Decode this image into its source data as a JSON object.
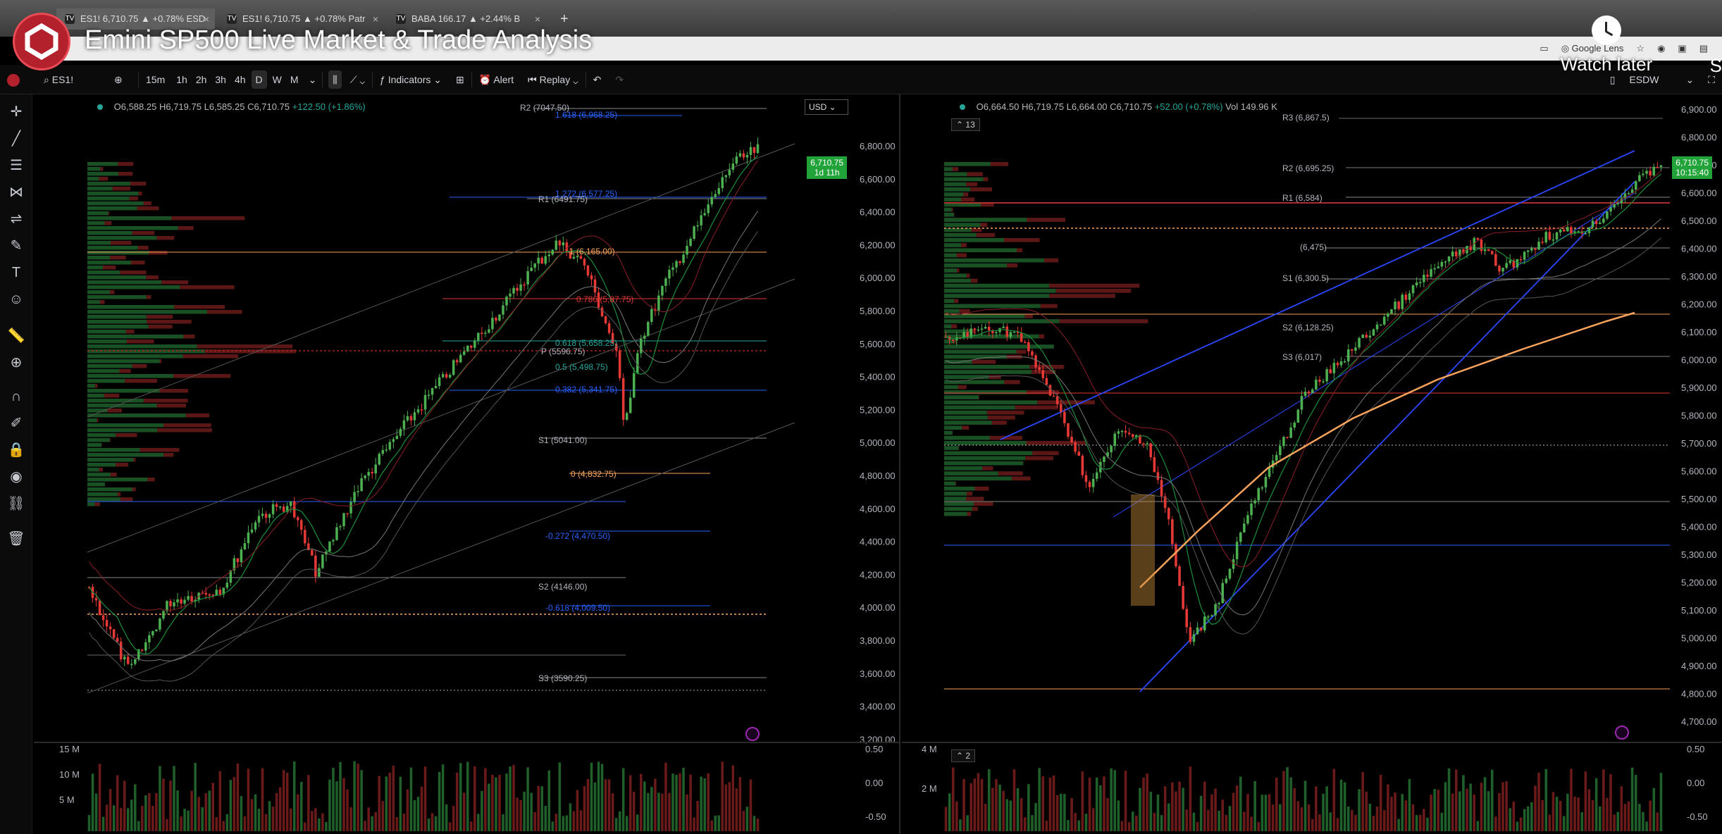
{
  "browser": {
    "tabs": [
      {
        "label": "ES1! 6,710.75 ▲ +0.78% ESD",
        "favicon": "TV"
      },
      {
        "label": "ES1! 6,710.75 ▲ +0.78% Patr",
        "favicon": "TV"
      },
      {
        "label": "BABA 166.17 ▲ +2.44% B",
        "favicon": "TV"
      }
    ],
    "google_lens_label": "Google Lens"
  },
  "video": {
    "title": "Emini SP500 Live Market & Trade Analysis",
    "watch_later": "Watch later",
    "share_initial": "S"
  },
  "toolbar": {
    "symbol": "ES1!",
    "intervals": [
      "15m",
      "1h",
      "2h",
      "3h",
      "4h",
      "D",
      "W",
      "M"
    ],
    "active_interval": "D",
    "indicators_label": "Indicators",
    "alert_label": "Alert",
    "replay_label": "Replay",
    "right_symbol": "ESDW"
  },
  "left_chart": {
    "ohlc": {
      "o": "O6,588.25",
      "h": "H6,719.75",
      "l": "L6,585.25",
      "c": "C6,710.75",
      "chg": "+122.50 (+1.86%)"
    },
    "currency": "USD",
    "price_tag": {
      "price": "6,710.75",
      "countdown": "1d 11h"
    },
    "axis": [
      "6,800.00",
      "6,600.00",
      "6,400.00",
      "6,200.00",
      "6,000.00",
      "5,800.00",
      "5,600.00",
      "5,400.00",
      "5,200.00",
      "5,000.00",
      "4,800.00",
      "4,600.00",
      "4,400.00",
      "4,200.00",
      "4,000.00",
      "3,800.00",
      "3,600.00",
      "3,400.00",
      "3,200.00"
    ],
    "levels": [
      {
        "label": "R2 (7047.50)",
        "color": "#b2b5be"
      },
      {
        "label": "1.618 (6,968.25)",
        "color": "#2962ff"
      },
      {
        "label": "1.272 (6,577.25)",
        "color": "#2962ff"
      },
      {
        "label": "R1 (6491.75)",
        "color": "#b2b5be"
      },
      {
        "label": "1 (6,165.00)",
        "color": "#f7a35c"
      },
      {
        "label": "0.786 (5,87.75)",
        "color": "#e53935"
      },
      {
        "label": "0.618 (5,658.25)",
        "color": "#26a69a"
      },
      {
        "label": "P (5596.75)",
        "color": "#b2b5be"
      },
      {
        "label": "0.5 (5,498.75)",
        "color": "#26a69a"
      },
      {
        "label": "0.382 (5,341.75)",
        "color": "#2962ff"
      },
      {
        "label": "S1 (5041.00)",
        "color": "#b2b5be"
      },
      {
        "label": "0 (4,832.75)",
        "color": "#f7a35c"
      },
      {
        "label": "-0.272 (4,470.50)",
        "color": "#2962ff"
      },
      {
        "label": "S2 (4146.00)",
        "color": "#b2b5be"
      },
      {
        "label": "-0.618 (4,009.50)",
        "color": "#2962ff"
      },
      {
        "label": "S3 (3590.25)",
        "color": "#b2b5be"
      }
    ],
    "volume_axis": [
      "15 M",
      "10 M",
      "5 M"
    ],
    "osc_axis": [
      "0.50",
      "0.00",
      "-0.50"
    ]
  },
  "right_chart": {
    "ohlc": {
      "o": "O6,664.50",
      "h": "H6,719.75",
      "l": "L6,664.00",
      "c": "C6,710.75",
      "chg": "+52.00 (+0.78%)",
      "vol": "Vol 149.96 K"
    },
    "counter": "13",
    "counter2": "2",
    "price_tag": {
      "price": "6,710.75",
      "countdown": "10:15:40"
    },
    "axis": [
      "6,900.00",
      "6,800.00",
      "6,700.00",
      "6,600.00",
      "6,500.00",
      "6,400.00",
      "6,300.00",
      "6,200.00",
      "6,100.00",
      "6,000.00",
      "5,900.00",
      "5,800.00",
      "5,700.00",
      "5,600.00",
      "5,500.00",
      "5,400.00",
      "5,300.00",
      "5,200.00",
      "5,100.00",
      "5,000.00",
      "4,900.00",
      "4,800.00",
      "4,700.00"
    ],
    "levels": [
      {
        "label": "R3 (6,867.5)"
      },
      {
        "label": "R2 (6,695.25)"
      },
      {
        "label": "R1 (6,584)"
      },
      {
        "label": "(6,475)"
      },
      {
        "label": "S1 (6,300.5)"
      },
      {
        "label": "S2 (6,128.25)"
      },
      {
        "label": "S3 (6,017)"
      }
    ],
    "volume_axis": [
      "4 M",
      "2 M"
    ],
    "osc_axis": [
      "0.50",
      "0.00",
      "-0.50"
    ]
  },
  "colors": {
    "up": "#26a69a",
    "up_bright": "#4caf50",
    "down": "#e53935",
    "accent": "#22a33a"
  }
}
